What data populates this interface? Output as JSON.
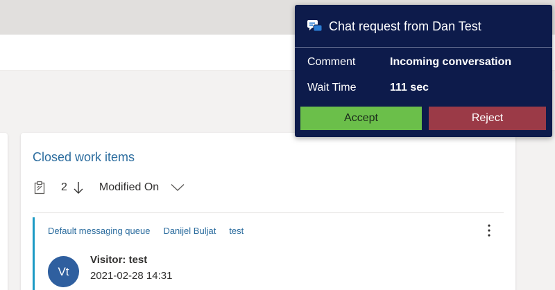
{
  "chat_request": {
    "title": "Chat request from Dan Test",
    "icon": "chat-bubble-icon",
    "comment_label": "Comment",
    "comment_value": "Incoming conversation",
    "wait_label": "Wait Time",
    "wait_value": "111 sec",
    "accept_label": "Accept",
    "reject_label": "Reject",
    "colors": {
      "background": "#0d1b4b",
      "accept": "#6bbf4a",
      "reject": "#9b3a47"
    }
  },
  "closed_items": {
    "title": "Closed work items",
    "count": "2",
    "sort_field": "Modified On",
    "icons": [
      "clipboard-icon",
      "sort-descending-icon",
      "chevron-down-icon"
    ],
    "items": [
      {
        "tags": [
          "Default messaging queue",
          "Danijel Buljat",
          "test"
        ],
        "avatar_initials": "Vt",
        "title": "Visitor: test",
        "timestamp": "2021-02-28 14:31"
      }
    ]
  }
}
